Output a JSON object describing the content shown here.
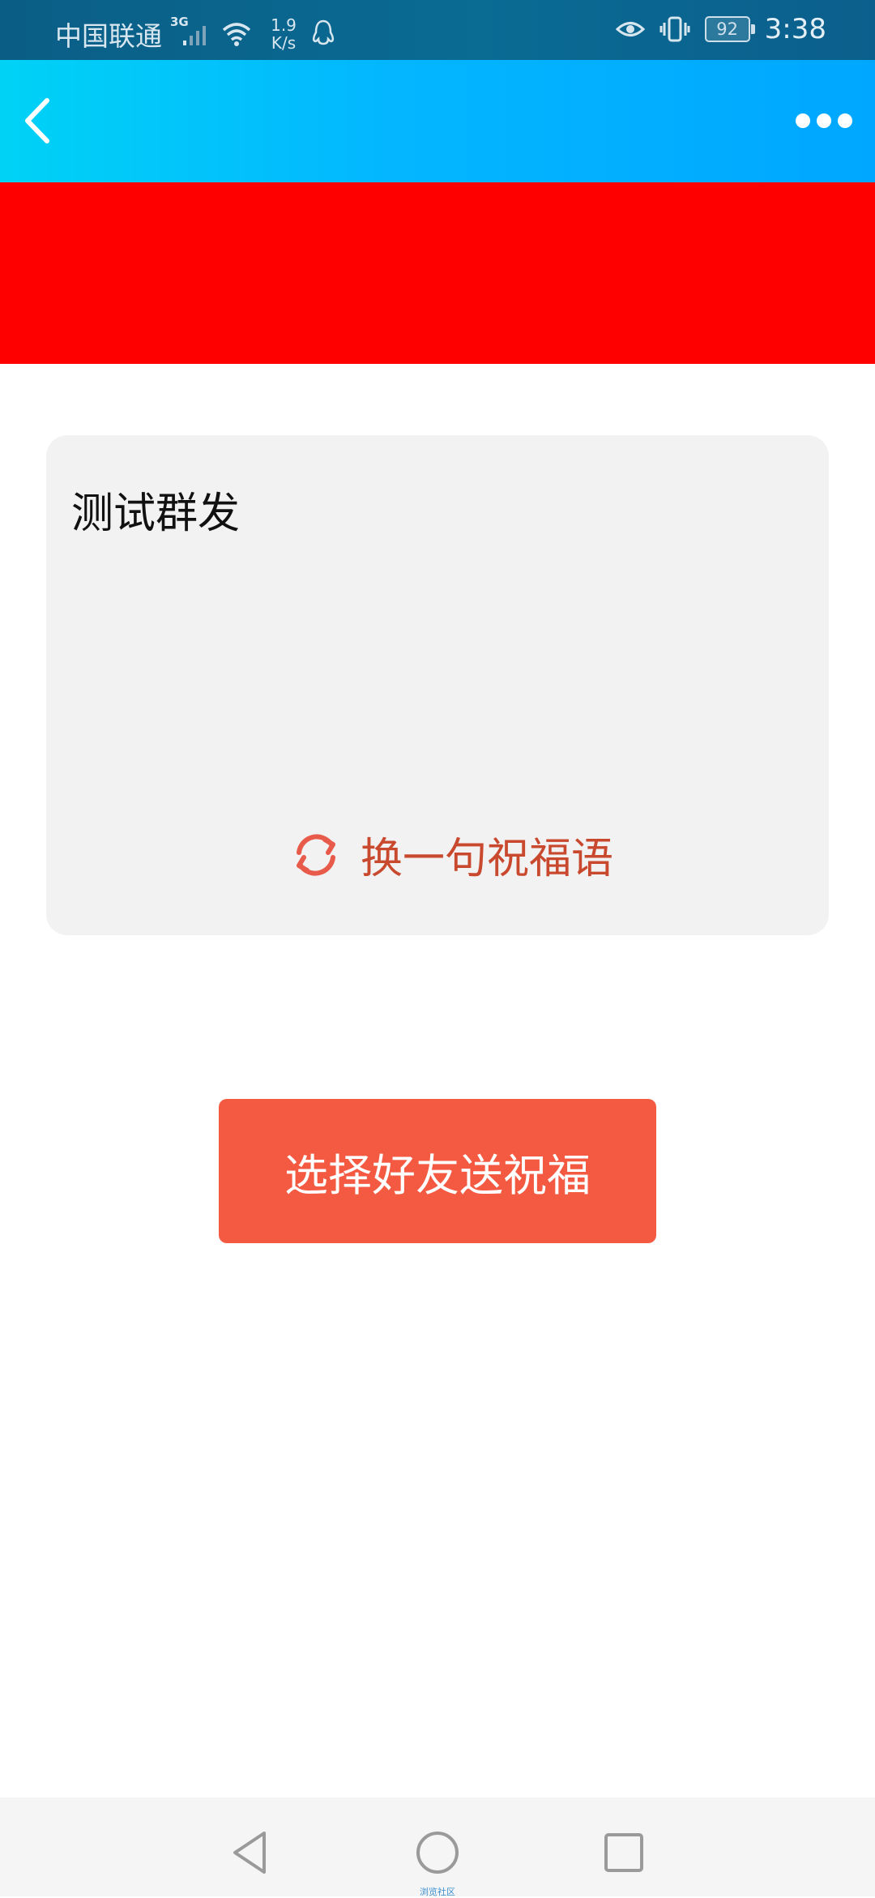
{
  "status_bar": {
    "carrier": "中国联通",
    "network_type": "3G",
    "speed_value": "1.9",
    "speed_unit": "K/s",
    "battery": "92",
    "time": "3:38"
  },
  "header": {
    "back_icon": "chevron-left-icon",
    "more_icon": "more-dots-icon"
  },
  "card": {
    "message": "测试群发",
    "swap_label": "换一句祝福语",
    "swap_icon": "refresh-icon"
  },
  "primary_button": {
    "label": "选择好友送祝福"
  },
  "system_nav": {
    "caption": "浏览社区"
  },
  "colors": {
    "accent": "#f45a41",
    "swap_text": "#c9492e",
    "header_gradient_start": "#00d2f6",
    "header_gradient_end": "#00a7ff",
    "banner": "#ff0000"
  }
}
